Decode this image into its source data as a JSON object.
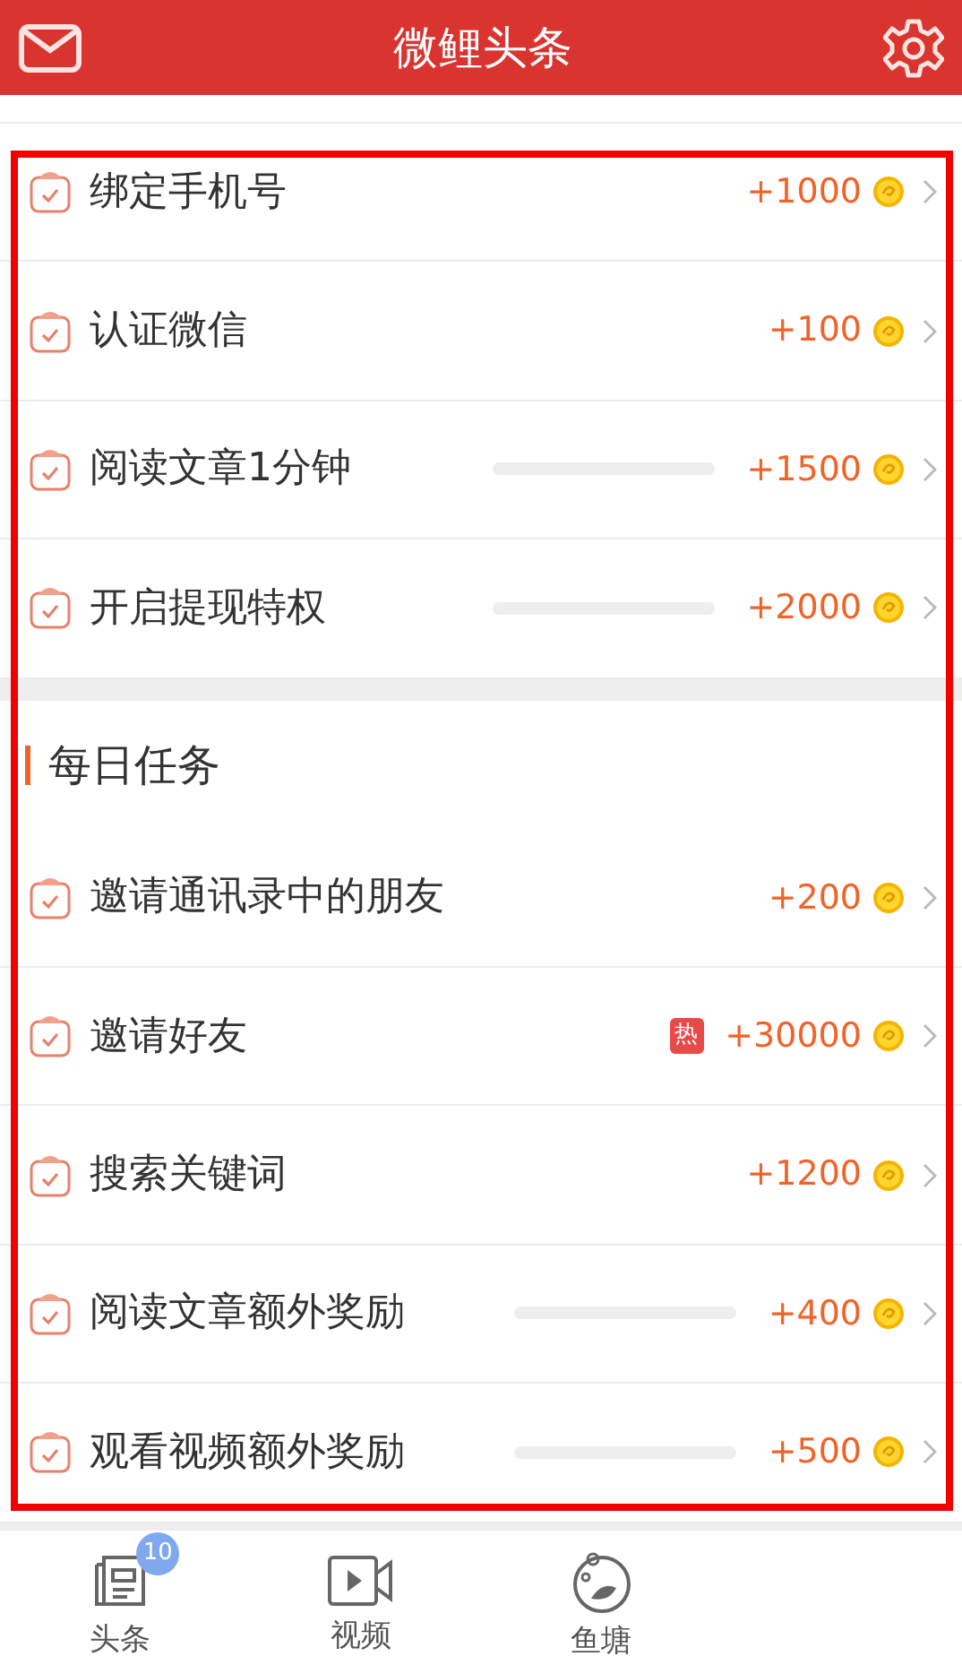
{
  "header": {
    "title": "微鲤头条"
  },
  "newbie_tasks": [
    {
      "name": "绑定手机号",
      "reward": "+1000"
    },
    {
      "name": "认证微信",
      "reward": "+100"
    },
    {
      "name": "阅读文章1分钟",
      "reward": "+1500",
      "level": 0
    },
    {
      "name": "开启提现特权",
      "reward": "+2000",
      "level": 0
    }
  ],
  "daily_section": {
    "title": "每日任务"
  },
  "daily_tasks": [
    {
      "name": "邀请通讯录中的朋友",
      "reward": "+200"
    },
    {
      "name": "邀请好友",
      "reward": "+30000",
      "badge": "热"
    },
    {
      "name": "搜索关键词",
      "reward": "+1200"
    },
    {
      "name": "阅读文章额外奖励",
      "reward": "+400",
      "level": 0
    },
    {
      "name": "观看视频额外奖励",
      "reward": "+500",
      "level": 0
    }
  ],
  "tab_bar": [
    {
      "kind": "news",
      "label": "头条",
      "badge": "10"
    },
    {
      "kind": "video",
      "label": "视频"
    },
    {
      "kind": "pond",
      "label": "鱼塘"
    }
  ]
}
